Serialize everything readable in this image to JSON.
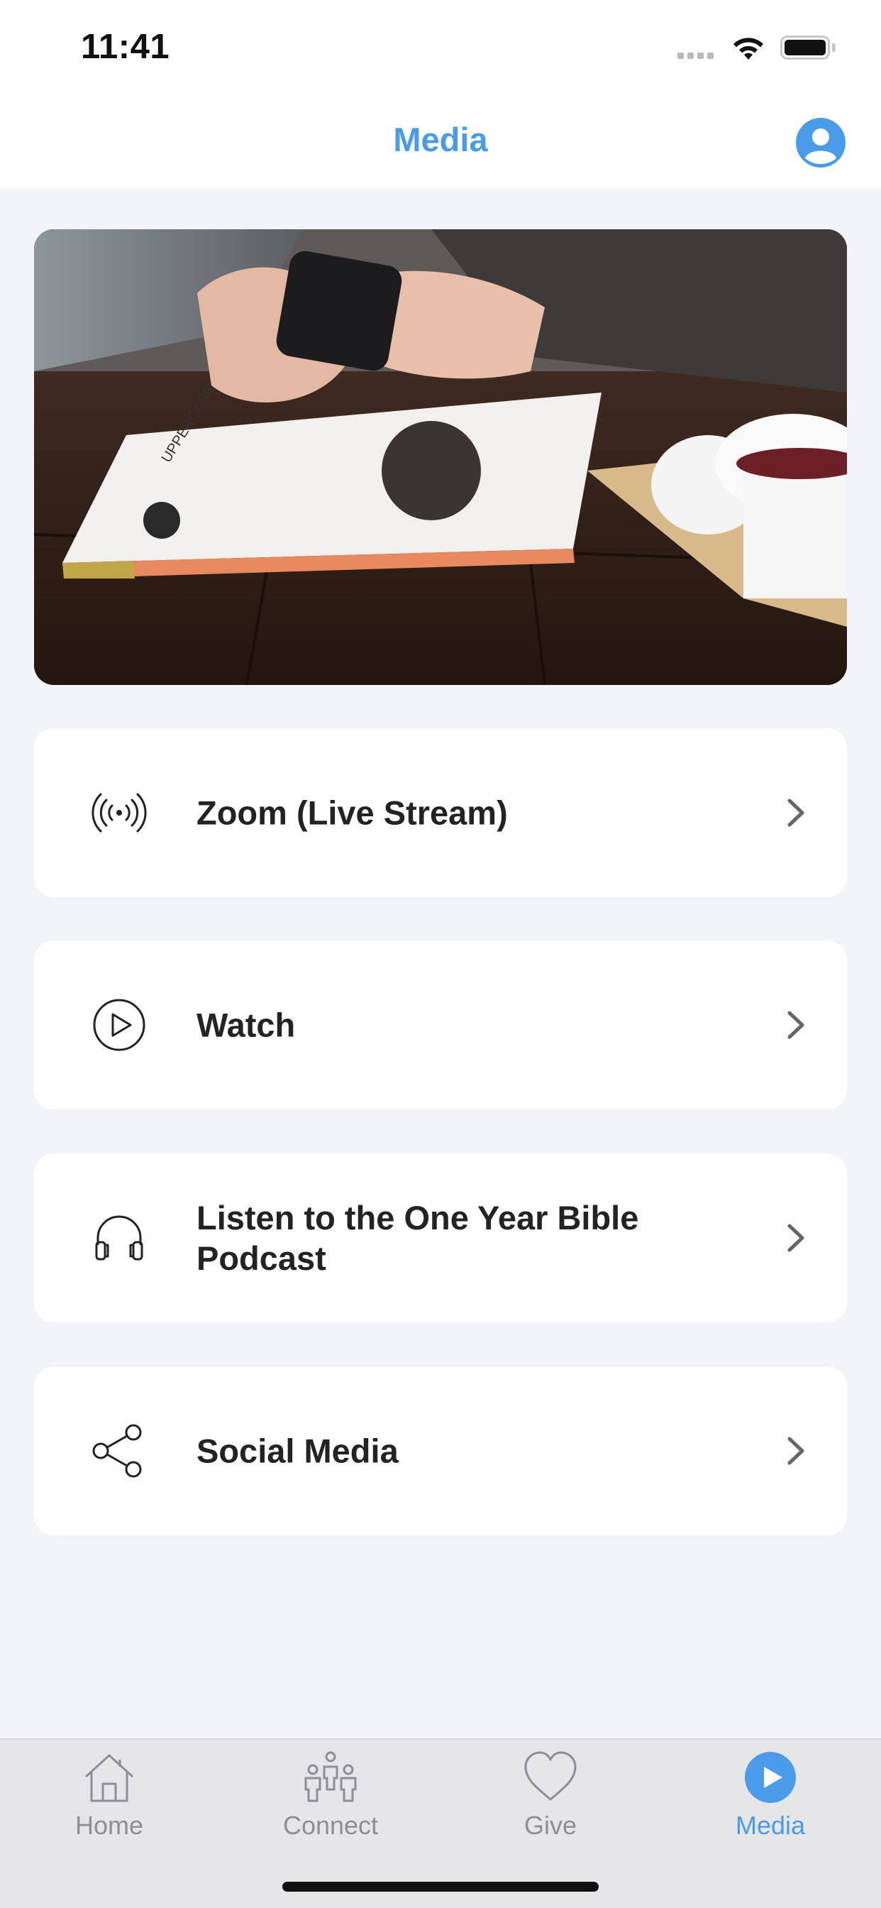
{
  "status_bar": {
    "time": "11:41"
  },
  "nav": {
    "title": "Media",
    "profile_icon": "person-circle-icon"
  },
  "hero": {
    "image": "hands-holding-phone-magazine-coffee",
    "magazine_text": "UPPERCASE"
  },
  "menu": {
    "items": [
      {
        "label": "Zoom (Live Stream)",
        "icon": "broadcast-icon"
      },
      {
        "label": "Watch",
        "icon": "play-circle-icon"
      },
      {
        "label": "Listen to the One Year Bible Podcast",
        "icon": "headphones-icon"
      },
      {
        "label": "Social Media",
        "icon": "share-icon"
      }
    ]
  },
  "tab_bar": {
    "tabs": [
      {
        "label": "Home",
        "icon": "house-icon"
      },
      {
        "label": "Connect",
        "icon": "people-icon"
      },
      {
        "label": "Give",
        "icon": "heart-icon"
      },
      {
        "label": "Media",
        "icon": "play-circle-filled-icon"
      }
    ],
    "active": "Media"
  },
  "colors": {
    "accent": "#4a9be8",
    "background": "#f3f4f8",
    "card": "#ffffff",
    "text": "#232323",
    "tab_inactive": "#8e8e93"
  }
}
